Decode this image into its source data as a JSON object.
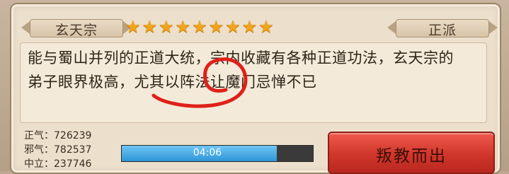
{
  "sect": {
    "name": "玄天宗",
    "alignment": "正派",
    "star_rating": 9,
    "star_max": 9
  },
  "description": {
    "line1": "能与蜀山并列的正道大统，宗内收藏有各种正道功法，玄天宗的",
    "line2": "弟子眼界极高，尤其以阵法让魔门忌惮不已"
  },
  "stats": {
    "righteous_label": "正气：",
    "righteous_value": "726239",
    "evil_label": "邪气：",
    "evil_value": "782537",
    "neutral_label": "中立：",
    "neutral_value": "237746"
  },
  "timer": {
    "text": "04:06",
    "progress": 0.81
  },
  "actions": {
    "defect_label": "叛教而出"
  },
  "colors": {
    "accent_red": "#d0362b",
    "progress_blue": "#2f95d6",
    "star_gold": "#f2a51a",
    "annotation_red": "#e0201a"
  },
  "icons": [
    "star-icon"
  ]
}
